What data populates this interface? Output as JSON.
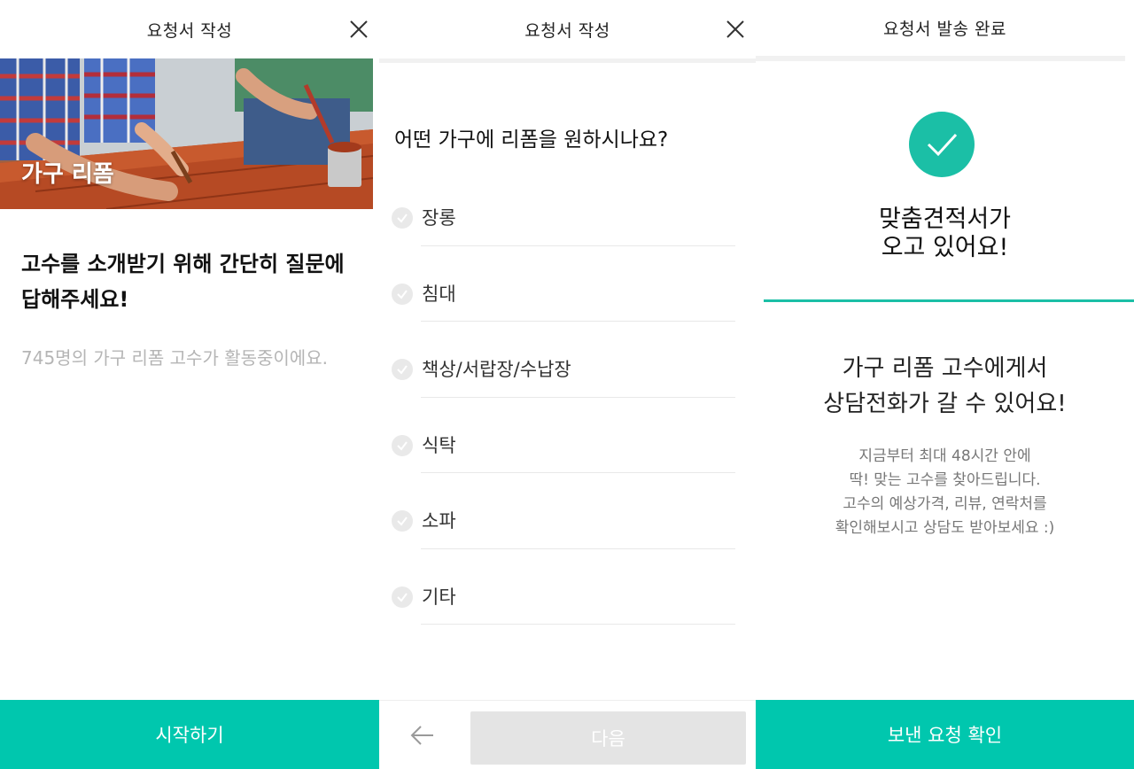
{
  "panel1": {
    "header_title": "요청서 작성",
    "hero_label": "가구 리폼",
    "intro_line1": "고수를 소개받기 위해 간단히 질문에",
    "intro_line2": "답해주세요!",
    "count_text": "745명의 가구 리폼 고수가 활동중이에요.",
    "cta_label": "시작하기"
  },
  "panel2": {
    "header_title": "요청서 작성",
    "question": "어떤 가구에 리폼을 원하시나요?",
    "options": [
      {
        "label": "장롱"
      },
      {
        "label": "침대"
      },
      {
        "label": "책상/서랍장/수납장"
      },
      {
        "label": "식탁"
      },
      {
        "label": "소파"
      },
      {
        "label": "기타"
      }
    ],
    "next_label": "다음"
  },
  "panel3": {
    "header_title": "요청서 발송 완료",
    "headline_line1": "맞춤견적서가",
    "headline_line2": "오고 있어요!",
    "subhead_line1": "가구 리폼 고수에게서",
    "subhead_line2": "상담전화가 갈 수 있어요!",
    "desc_lines": [
      "지금부터 최대 48시간 안에",
      "딱! 맞는 고수를 찾아드립니다.",
      "고수의 예상가격, 리뷰, 연락처를",
      "확인해보시고 상담도 받아보세요 :)"
    ],
    "cta_label": "보낸 요청 확인"
  },
  "colors": {
    "accent": "#00c7ae",
    "success": "#1bbfa6",
    "disabled_button": "#e4e4e4",
    "muted_text": "#b5b5b5"
  },
  "icons": {
    "close": "close-icon",
    "back": "arrow-left-icon",
    "check": "check-icon"
  }
}
